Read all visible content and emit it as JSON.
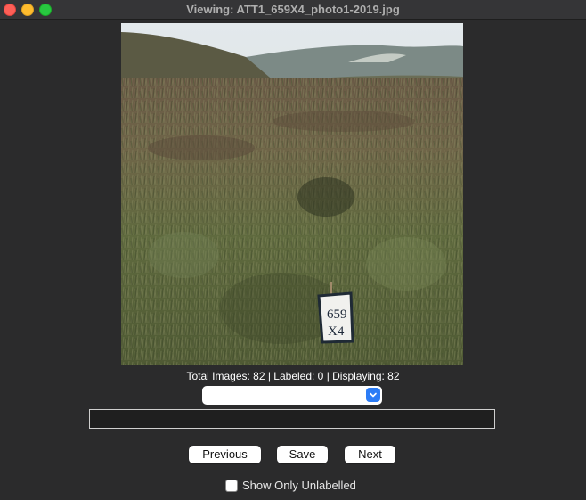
{
  "window": {
    "title": "Viewing: ATT1_659X4_photo1-2019.jpg"
  },
  "photo": {
    "description_icon": "photo-icon",
    "marker_text_line1": "659",
    "marker_text_line2": "X4"
  },
  "status": {
    "stats_text": "Total Images: 82 | Labeled: 0 | Displaying: 82"
  },
  "label_dropdown": {
    "selected": ""
  },
  "label_input": {
    "value": ""
  },
  "buttons": {
    "previous_label": "Previous",
    "save_label": "Save",
    "next_label": "Next"
  },
  "filter": {
    "show_only_unlabelled_label": "Show Only Unlabelled",
    "checked": false
  },
  "colors": {
    "background": "#2b2b2c",
    "accent": "#2b7cf6"
  }
}
